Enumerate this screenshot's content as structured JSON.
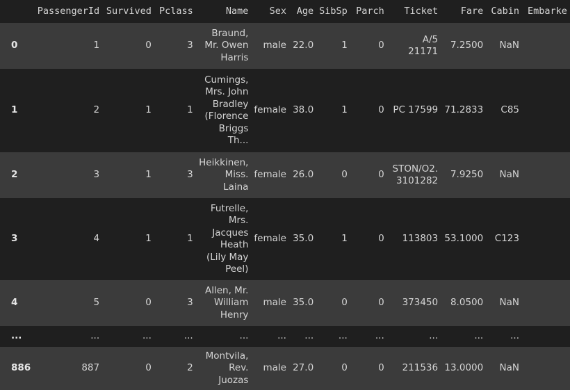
{
  "columns": [
    "PassengerId",
    "Survived",
    "Pclass",
    "Name",
    "Sex",
    "Age",
    "SibSp",
    "Parch",
    "Ticket",
    "Fare",
    "Cabin",
    "Embarke"
  ],
  "rows": [
    {
      "index": "0",
      "PassengerId": "1",
      "Survived": "0",
      "Pclass": "3",
      "Name": "Braund, Mr. Owen Harris",
      "Sex": "male",
      "Age": "22.0",
      "SibSp": "1",
      "Parch": "0",
      "Ticket": "A/5 21171",
      "Fare": "7.2500",
      "Cabin": "NaN",
      "Embarked": ""
    },
    {
      "index": "1",
      "PassengerId": "2",
      "Survived": "1",
      "Pclass": "1",
      "Name": "Cumings, Mrs. John Bradley (Florence Briggs Th...",
      "Sex": "female",
      "Age": "38.0",
      "SibSp": "1",
      "Parch": "0",
      "Ticket": "PC 17599",
      "Fare": "71.2833",
      "Cabin": "C85",
      "Embarked": ""
    },
    {
      "index": "2",
      "PassengerId": "3",
      "Survived": "1",
      "Pclass": "3",
      "Name": "Heikkinen, Miss. Laina",
      "Sex": "female",
      "Age": "26.0",
      "SibSp": "0",
      "Parch": "0",
      "Ticket": "STON/O2. 3101282",
      "Fare": "7.9250",
      "Cabin": "NaN",
      "Embarked": ""
    },
    {
      "index": "3",
      "PassengerId": "4",
      "Survived": "1",
      "Pclass": "1",
      "Name": "Futrelle, Mrs. Jacques Heath (Lily May Peel)",
      "Sex": "female",
      "Age": "35.0",
      "SibSp": "1",
      "Parch": "0",
      "Ticket": "113803",
      "Fare": "53.1000",
      "Cabin": "C123",
      "Embarked": ""
    },
    {
      "index": "4",
      "PassengerId": "5",
      "Survived": "0",
      "Pclass": "3",
      "Name": "Allen, Mr. William Henry",
      "Sex": "male",
      "Age": "35.0",
      "SibSp": "0",
      "Parch": "0",
      "Ticket": "373450",
      "Fare": "8.0500",
      "Cabin": "NaN",
      "Embarked": ""
    },
    {
      "index": "...",
      "PassengerId": "...",
      "Survived": "...",
      "Pclass": "...",
      "Name": "...",
      "Sex": "...",
      "Age": "...",
      "SibSp": "...",
      "Parch": "...",
      "Ticket": "...",
      "Fare": "...",
      "Cabin": "...",
      "Embarked": ""
    },
    {
      "index": "886",
      "PassengerId": "887",
      "Survived": "0",
      "Pclass": "2",
      "Name": "Montvila, Rev. Juozas",
      "Sex": "male",
      "Age": "27.0",
      "SibSp": "0",
      "Parch": "0",
      "Ticket": "211536",
      "Fare": "13.0000",
      "Cabin": "NaN",
      "Embarked": ""
    }
  ]
}
